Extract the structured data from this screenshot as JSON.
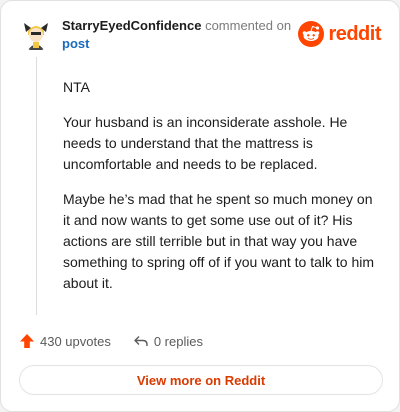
{
  "header": {
    "username": "StarryEyedConfidence",
    "action_text": "commented on",
    "post_link": "post",
    "brand_name": "reddit",
    "brand_color": "#ff4500"
  },
  "comment": {
    "paragraphs": [
      "NTA",
      "Your husband is an inconsiderate asshole. He needs to understand that the mattress is uncomfortable and needs to be replaced.",
      "Maybe he’s mad that he spent so much money on it and now wants to get some use out of it? His actions are still terrible but in that way you have something to spring off of if you want to talk to him about it."
    ]
  },
  "stats": {
    "upvotes_label": "430 upvotes",
    "replies_label": "0 replies",
    "upvote_icon": "upvote-arrow-icon",
    "reply_icon": "reply-arrow-icon"
  },
  "actions": {
    "view_more_label": "View more on Reddit"
  }
}
